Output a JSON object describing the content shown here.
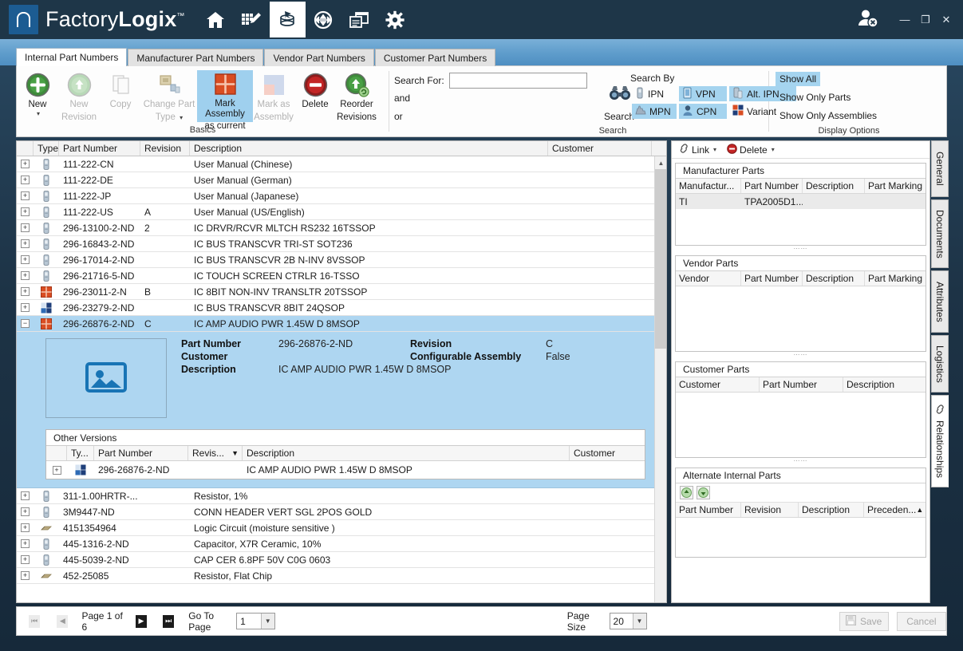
{
  "titlebar": {
    "brand_first": "Factory",
    "brand_second": "Logix",
    "brand_tm": "™",
    "nav_icons": [
      "home-icon",
      "edit-grid-icon",
      "parts-database-icon",
      "navigate-icon",
      "windows-icon",
      "settings-gear-icon"
    ],
    "user_label": "user-signout-icon",
    "minimize": "—",
    "maximize": "❐",
    "close": "✕"
  },
  "tabs": [
    {
      "label": "Internal Part Numbers",
      "active": true
    },
    {
      "label": "Manufacturer Part Numbers",
      "active": false
    },
    {
      "label": "Vendor Part Numbers",
      "active": false
    },
    {
      "label": "Customer Part Numbers",
      "active": false
    }
  ],
  "ribbon": {
    "basics_label": "Basics",
    "search_group_label": "Search",
    "display_group_label": "Display Options",
    "buttons": [
      {
        "label": "New",
        "sub": "",
        "state": "enabled",
        "dropdown": true,
        "icon": "new-plus-icon"
      },
      {
        "label": "New",
        "sub": "Revision",
        "state": "disabled",
        "dropdown": false,
        "icon": "new-revision-up-icon"
      },
      {
        "label": "Copy",
        "sub": "",
        "state": "disabled",
        "dropdown": false,
        "icon": "copy-pages-icon"
      },
      {
        "label": "Change Part",
        "sub": "Type",
        "state": "disabled",
        "dropdown": true,
        "icon": "change-part-type-icon"
      },
      {
        "label": "Mark Assembly",
        "sub": "as current",
        "state": "selected",
        "dropdown": false,
        "icon": "mark-assembly-current-icon"
      },
      {
        "label": "Mark as",
        "sub": "Assembly",
        "state": "disabled",
        "dropdown": false,
        "icon": "mark-as-assembly-icon"
      },
      {
        "label": "Delete",
        "sub": "",
        "state": "enabled",
        "dropdown": false,
        "icon": "delete-icon"
      },
      {
        "label": "Reorder",
        "sub": "Revisions",
        "state": "enabled",
        "dropdown": false,
        "icon": "reorder-revisions-icon"
      }
    ],
    "search": {
      "label": "Search For:",
      "value": "",
      "placeholder": "",
      "and_label": "and",
      "or_label": "or",
      "search_button_label": "Search",
      "search_by_label": "Search By",
      "criteria": [
        {
          "label": "IPN",
          "on": false,
          "icon": "ipn-icon"
        },
        {
          "label": "VPN",
          "on": true,
          "icon": "vpn-icon"
        },
        {
          "label": "Alt. IPN",
          "on": true,
          "icon": "alt-ipn-icon"
        },
        {
          "label": "MPN",
          "on": true,
          "icon": "mpn-icon"
        },
        {
          "label": "CPN",
          "on": true,
          "icon": "cpn-icon"
        },
        {
          "label": "Variant",
          "on": false,
          "icon": "variant-icon"
        }
      ]
    },
    "display_options": [
      {
        "label": "Show All",
        "on": true
      },
      {
        "label": "Show Only Parts",
        "on": false
      },
      {
        "label": "Show Only Assemblies",
        "on": false
      }
    ]
  },
  "grid": {
    "columns": [
      "",
      "Type",
      "Part Number",
      "Revision",
      "Description",
      "Customer"
    ],
    "rows": [
      {
        "type": "part-icon",
        "part_number": "111-222-CN",
        "revision": "",
        "description": "User Manual (Chinese)",
        "customer": "",
        "selected": false,
        "expanded": false
      },
      {
        "type": "part-icon",
        "part_number": "111-222-DE",
        "revision": "",
        "description": "User Manual (German)",
        "customer": "",
        "selected": false,
        "expanded": false
      },
      {
        "type": "part-icon",
        "part_number": "111-222-JP",
        "revision": "",
        "description": "User Manual (Japanese)",
        "customer": "",
        "selected": false,
        "expanded": false
      },
      {
        "type": "part-icon",
        "part_number": "111-222-US",
        "revision": "A",
        "description": "User Manual (US/English)",
        "customer": "",
        "selected": false,
        "expanded": false
      },
      {
        "type": "part-icon",
        "part_number": "296-13100-2-ND",
        "revision": "2",
        "description": "IC DRVR/RCVR MLTCH RS232 16TSSOP",
        "customer": "",
        "selected": false,
        "expanded": false
      },
      {
        "type": "part-icon",
        "part_number": "296-16843-2-ND",
        "revision": "",
        "description": "IC BUS TRANSCVR TRI-ST SOT236",
        "customer": "",
        "selected": false,
        "expanded": false
      },
      {
        "type": "part-icon",
        "part_number": "296-17014-2-ND",
        "revision": "",
        "description": "IC BUS TRANSCVR 2B N-INV 8VSSOP",
        "customer": "",
        "selected": false,
        "expanded": false
      },
      {
        "type": "part-icon",
        "part_number": "296-21716-5-ND",
        "revision": "",
        "description": "IC TOUCH SCREEN CTRLR 16-TSSO",
        "customer": "",
        "selected": false,
        "expanded": false
      },
      {
        "type": "assembly-icon",
        "part_number": "296-23011-2-N",
        "revision": "B",
        "description": "IC 8BIT NON-INV TRANSLTR 20TSSOP",
        "customer": "",
        "selected": false,
        "expanded": false
      },
      {
        "type": "variant-icon",
        "part_number": "296-23279-2-ND",
        "revision": "",
        "description": "IC BUS TRANSCVR 8BIT 24QSOP",
        "customer": "",
        "selected": false,
        "expanded": false
      },
      {
        "type": "assembly-icon",
        "part_number": "296-26876-2-ND",
        "revision": "C",
        "description": "IC AMP AUDIO PWR 1.45W D 8MSOP",
        "customer": "",
        "selected": true,
        "expanded": true
      }
    ],
    "rows_after": [
      {
        "type": "part-icon",
        "part_number": "311-1.00HRTR-...",
        "revision": "",
        "description": "Resistor, 1%",
        "customer": ""
      },
      {
        "type": "part-icon",
        "part_number": "3M9447-ND",
        "revision": "",
        "description": "CONN HEADER VERT SGL 2POS GOLD",
        "customer": ""
      },
      {
        "type": "chip-icon",
        "part_number": "4151354964",
        "revision": "",
        "description": "Logic Circuit (moisture sensitive )",
        "customer": ""
      },
      {
        "type": "part-icon",
        "part_number": "445-1316-2-ND",
        "revision": "",
        "description": "Capacitor,  X7R Ceramic, 10%",
        "customer": ""
      },
      {
        "type": "part-icon",
        "part_number": "445-5039-2-ND",
        "revision": "",
        "description": "CAP CER 6.8PF 50V C0G 0603",
        "customer": ""
      },
      {
        "type": "chip-icon",
        "part_number": "452-25085",
        "revision": "",
        "description": "Resistor, Flat Chip",
        "customer": ""
      }
    ]
  },
  "detail": {
    "image_placeholder": "image-placeholder-icon",
    "fields": [
      {
        "label": "Part Number",
        "value": "296-26876-2-ND"
      },
      {
        "label": "Customer",
        "value": ""
      },
      {
        "label": "Description",
        "value": "IC AMP AUDIO PWR 1.45W D 8MSOP"
      }
    ],
    "fields_right": [
      {
        "label": "Revision",
        "value": "C"
      },
      {
        "label": "Configurable Assembly",
        "value": "False"
      }
    ],
    "other_versions": {
      "title": "Other Versions",
      "columns": [
        "",
        "Ty...",
        "Part Number",
        "Revis...",
        "Description",
        "Customer"
      ],
      "sort_indicator": "▼",
      "rows": [
        {
          "type": "variant-icon",
          "part_number": "296-26876-2-ND",
          "revision": "",
          "description": "IC AMP AUDIO PWR 1.45W D 8MSOP",
          "customer": ""
        }
      ]
    }
  },
  "right_panel": {
    "toolbar": [
      {
        "label": "Link",
        "icon": "link-icon",
        "dropdown": true
      },
      {
        "label": "Delete",
        "icon": "delete-circle-icon",
        "dropdown": true
      }
    ],
    "sections": [
      {
        "title": "Manufacturer Parts",
        "columns": [
          "Manufactur...",
          "Part Number",
          "Description",
          "Part Marking"
        ],
        "rows": [
          {
            "cells": [
              "TI",
              "TPA2005D1...",
              "",
              ""
            ],
            "selected": true
          }
        ]
      },
      {
        "title": "Vendor Parts",
        "columns": [
          "Vendor",
          "Part Number",
          "Description",
          "Part Marking"
        ],
        "rows": []
      },
      {
        "title": "Customer Parts",
        "columns": [
          "Customer",
          "Part Number",
          "Description"
        ],
        "rows": []
      },
      {
        "title": "Alternate Internal Parts",
        "columns": [
          "Part Number",
          "Revision",
          "Description",
          "Preceden..."
        ],
        "sort_indicator": "▲",
        "buttons": [
          "move-up-icon",
          "move-down-icon"
        ],
        "rows": []
      }
    ]
  },
  "vertical_tabs": [
    {
      "label": "General",
      "active": false
    },
    {
      "label": "Documents",
      "active": false
    },
    {
      "label": "Attributes",
      "active": false
    },
    {
      "label": "Logistics",
      "active": false
    },
    {
      "label": "Relationships",
      "active": true,
      "icon": "link-icon"
    }
  ],
  "footer": {
    "first_page": "⏮",
    "prev_page": "◀",
    "next_page": "▶",
    "last_page": "⏭",
    "page_status": "Page 1 of 6",
    "goto_label": "Go To Page",
    "goto_value": "1",
    "page_size_label": "Page Size",
    "page_size_value": "20",
    "save_label": "Save",
    "cancel_label": "Cancel"
  }
}
